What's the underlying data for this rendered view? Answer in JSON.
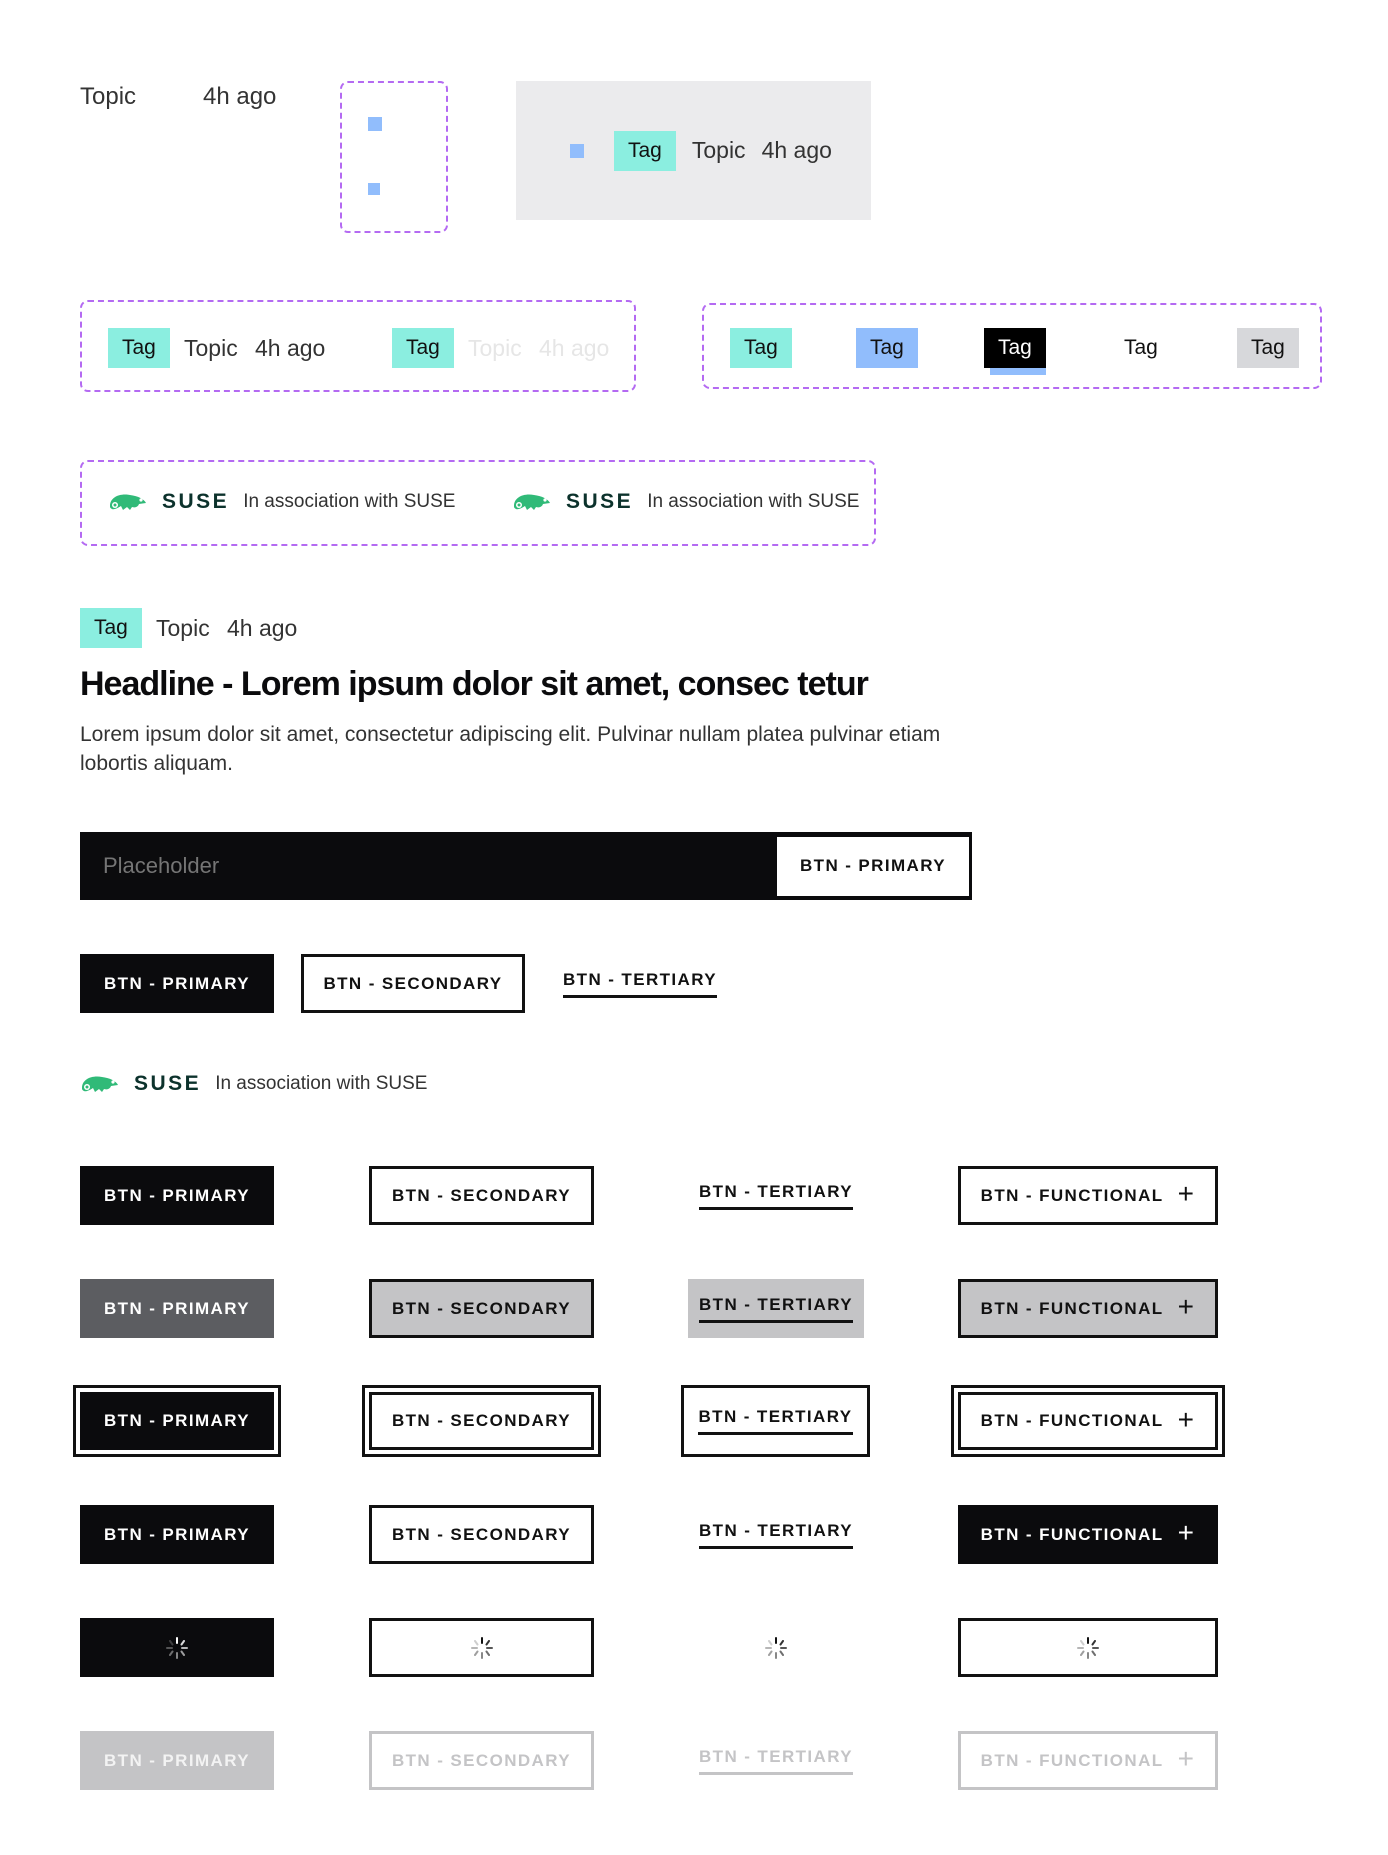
{
  "meta_row": {
    "topic": "Topic",
    "time": "4h ago"
  },
  "card_meta": {
    "tag": "Tag",
    "topic": "Topic",
    "time": "4h ago"
  },
  "meta_variants": [
    {
      "tag": "Tag",
      "topic": "Topic",
      "time": "4h ago"
    },
    {
      "tag": "Tag",
      "topic": "Topic",
      "time": "4h ago"
    }
  ],
  "tag_states": [
    "Tag",
    "Tag",
    "Tag",
    "Tag",
    "Tag"
  ],
  "sponsor": {
    "brand": "SUSE",
    "text": "In association with SUSE"
  },
  "sponsor_variants": [
    {
      "brand": "SUSE",
      "text": "In association with SUSE"
    },
    {
      "brand": "SUSE",
      "text": "In association with SUSE"
    }
  ],
  "article": {
    "tag": "Tag",
    "topic": "Topic",
    "time": "4h ago",
    "headline": "Headline - Lorem ipsum dolor sit amet, consec tetur",
    "body": "Lorem ipsum dolor sit amet, consectetur adipiscing elit. Pulvinar nullam platea pulvinar etiam lobortis aliquam."
  },
  "search": {
    "placeholder": "Placeholder",
    "button": "BTN - PRIMARY"
  },
  "buttons": {
    "primary": "BTN - PRIMARY",
    "secondary": "BTN - SECONDARY",
    "tertiary": "BTN - TERTIARY",
    "functional": "BTN - FUNCTIONAL"
  },
  "icons": {
    "plus": "plus-icon",
    "spinner": "spinner-icon",
    "chameleon": "chameleon-logo-icon"
  },
  "colors": {
    "tag_mint": "#8beee0",
    "tag_blue": "#91bdfc",
    "suse_green": "#30ba78",
    "suse_text": "#0c322c",
    "dash_purple": "#b46af2",
    "panel_grey": "#ebebed"
  }
}
